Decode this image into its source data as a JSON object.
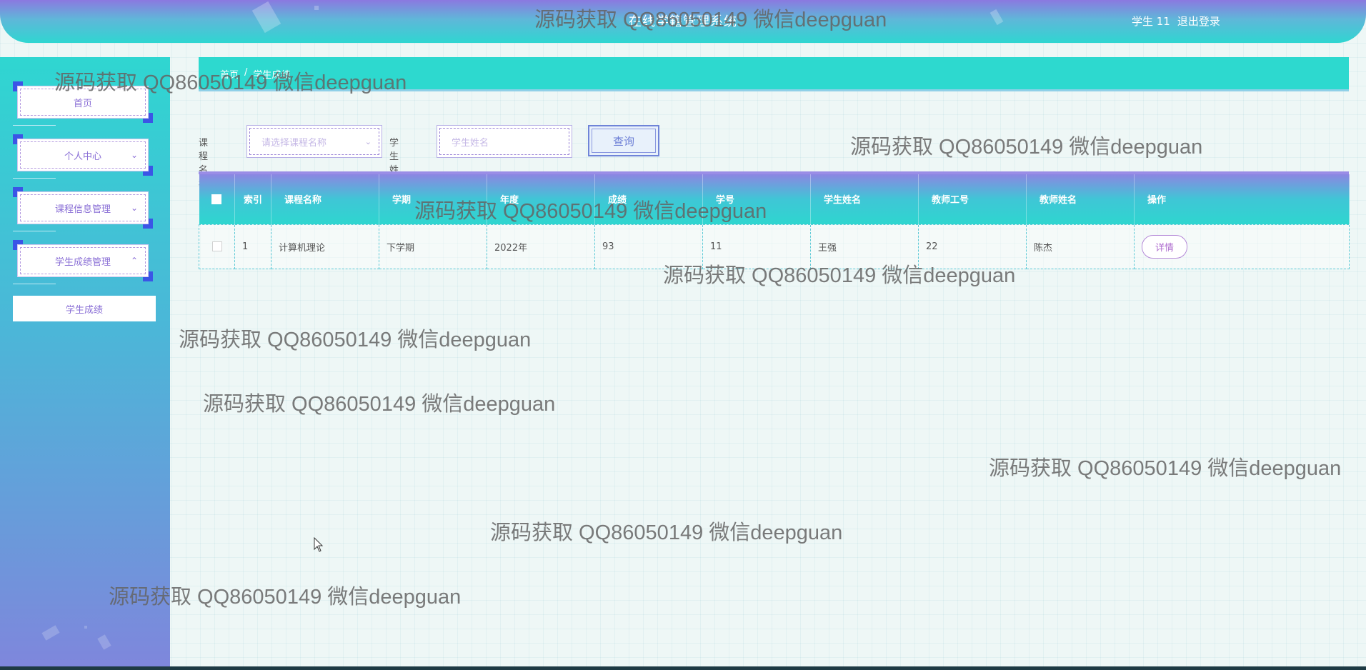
{
  "header": {
    "title": "在线学籍管理系统",
    "user_label": "学生 11",
    "logout_label": "退出登录"
  },
  "sidebar": {
    "items": [
      {
        "label": "首页"
      },
      {
        "label": "个人中心"
      },
      {
        "label": "课程信息管理"
      },
      {
        "label": "学生成绩管理"
      }
    ],
    "subitems": [
      {
        "label": "学生成绩"
      }
    ]
  },
  "breadcrumb": {
    "home": "首页",
    "separator": "/",
    "current": "学生成绩"
  },
  "search": {
    "course_label": "课程名称",
    "course_placeholder": "请选择课程名称",
    "student_label": "学生姓名",
    "student_placeholder": "学生姓名",
    "query_label": "查询"
  },
  "table": {
    "headers": [
      "索引",
      "课程名称",
      "学期",
      "年度",
      "成绩",
      "学号",
      "学生姓名",
      "教师工号",
      "教师姓名",
      "操作"
    ],
    "rows": [
      {
        "index": "1",
        "course": "计算机理论",
        "term": "下学期",
        "year": "2022年",
        "score": "93",
        "student_no": "11",
        "student_name": "王强",
        "teacher_no": "22",
        "teacher_name": "陈杰",
        "action": "详情"
      }
    ]
  },
  "watermark": "源码获取 QQ86050149 微信deepguan",
  "colors": {
    "accent": "#2dd9cf",
    "purple": "#8a6fd6",
    "header_top": "#8b79e0"
  }
}
